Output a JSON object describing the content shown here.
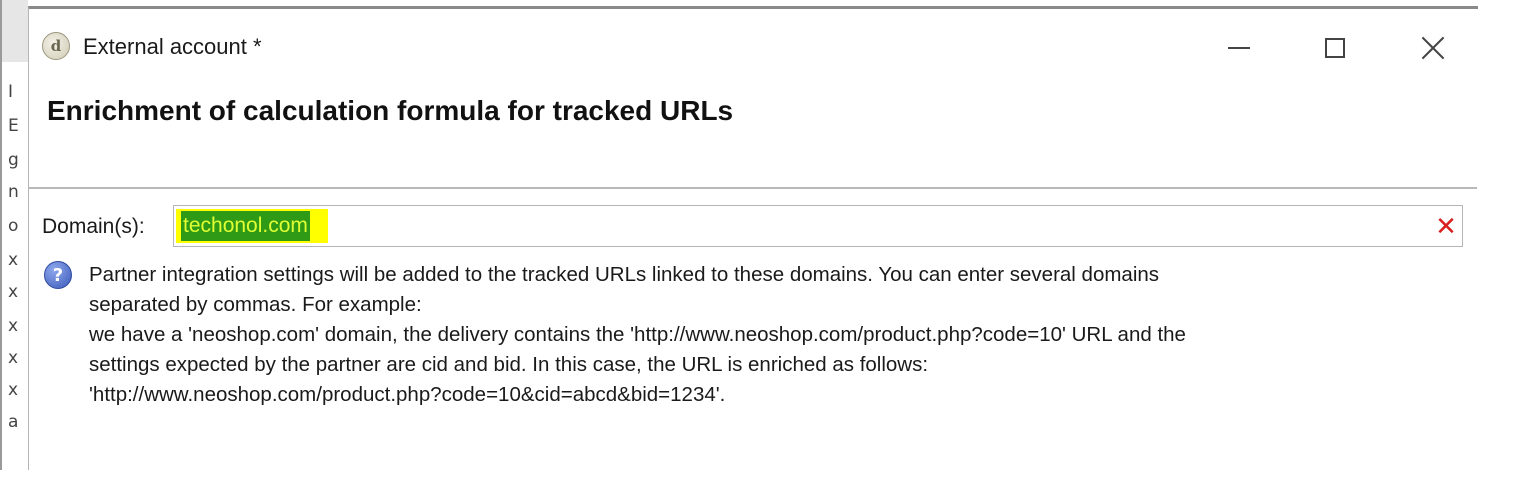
{
  "window": {
    "title": "External account *",
    "icon": "app-logo-icon"
  },
  "heading": "Enrichment of calculation formula for tracked URLs",
  "domain": {
    "label": "Domain(s):",
    "value": "techonol.com",
    "clear_icon": "clear-x-icon",
    "clear_color": "#d91f1f",
    "highlight_color": "#ffff00",
    "selection_color": "#2e9a15"
  },
  "help": {
    "icon": "help-question-icon",
    "lines": [
      "Partner integration settings will be added to the tracked URLs linked to these domains. You can enter several domains",
      "separated by commas. For example:",
      "we have a 'neoshop.com' domain, the delivery contains the 'http://www.neoshop.com/product.php?code=10' URL and the",
      "settings expected by the partner are cid and bid. In this case, the URL is enriched as follows:",
      "'http://www.neoshop.com/product.php?code=10&cid=abcd&bid=1234'."
    ]
  },
  "background_window": {
    "visible_chars": [
      "I",
      "E",
      "g",
      "n",
      "o",
      "x",
      "x",
      "x",
      "x",
      "x",
      "a"
    ]
  }
}
